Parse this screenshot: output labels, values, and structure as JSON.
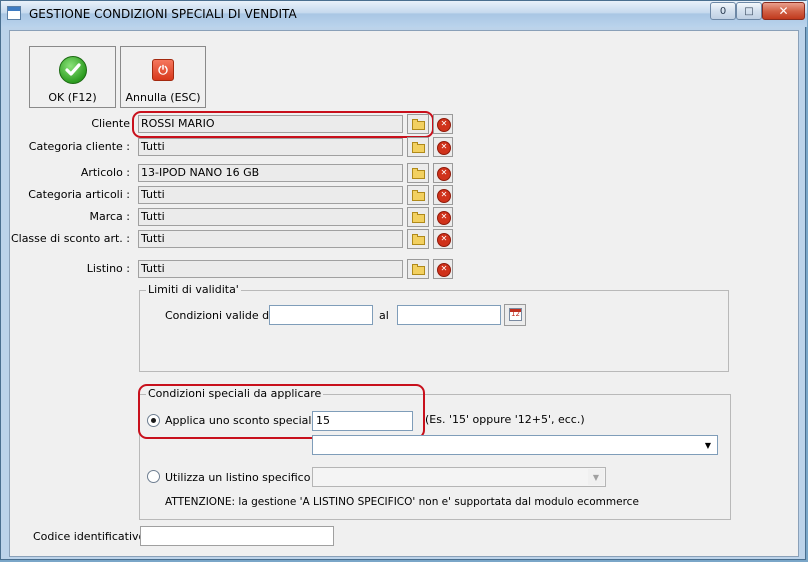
{
  "window": {
    "title": "GESTIONE CONDIZIONI SPECIALI DI VENDITA",
    "minimize": "0",
    "maximize": "□",
    "close": "✕"
  },
  "toolbar": {
    "ok_label": "OK (F12)",
    "cancel_label": "Annulla (ESC)"
  },
  "fields": {
    "cliente": {
      "label": "Cliente",
      "value": "ROSSI MARIO"
    },
    "categoria_cliente": {
      "label": "Categoria cliente :",
      "value": "Tutti"
    },
    "articolo": {
      "label": "Articolo :",
      "value": "13-IPOD NANO 16 GB"
    },
    "categoria_articoli": {
      "label": "Categoria articoli :",
      "value": "Tutti"
    },
    "marca": {
      "label": "Marca :",
      "value": "Tutti"
    },
    "classe_sconto": {
      "label": "Classe di sconto art. :",
      "value": "Tutti"
    },
    "listino": {
      "label": "Listino :",
      "value": "Tutti"
    }
  },
  "limiti": {
    "legend": "Limiti di validita'",
    "valide_dal_label": "Condizioni valide dal",
    "dal_value": "",
    "al_label": "al",
    "al_value": "",
    "calendar_text": "12"
  },
  "condizioni": {
    "legend": "Condizioni speciali da applicare",
    "sconto_label": "Applica uno sconto speciale",
    "sconto_value": "15",
    "sconto_hint": "(Es. '15' oppure '12+5', ecc.)",
    "sconto_selected": true,
    "listino_label": "Utilizza un listino specifico",
    "listino_selected": false,
    "warning": "ATTENZIONE: la gestione 'A LISTINO SPECIFICO' non e' supportata dal modulo ecommerce"
  },
  "codice": {
    "label": "Codice identificativo :",
    "value": ""
  },
  "colors": {
    "highlight": "#c8101c",
    "ok_green": "#2e9d21",
    "cancel_red": "#d8381c"
  },
  "icons": {
    "ok": "checkmark-icon",
    "cancel": "power-stop-icon",
    "browse": "folder-icon",
    "clear": "clear-x-icon",
    "calendar": "calendar-icon"
  }
}
